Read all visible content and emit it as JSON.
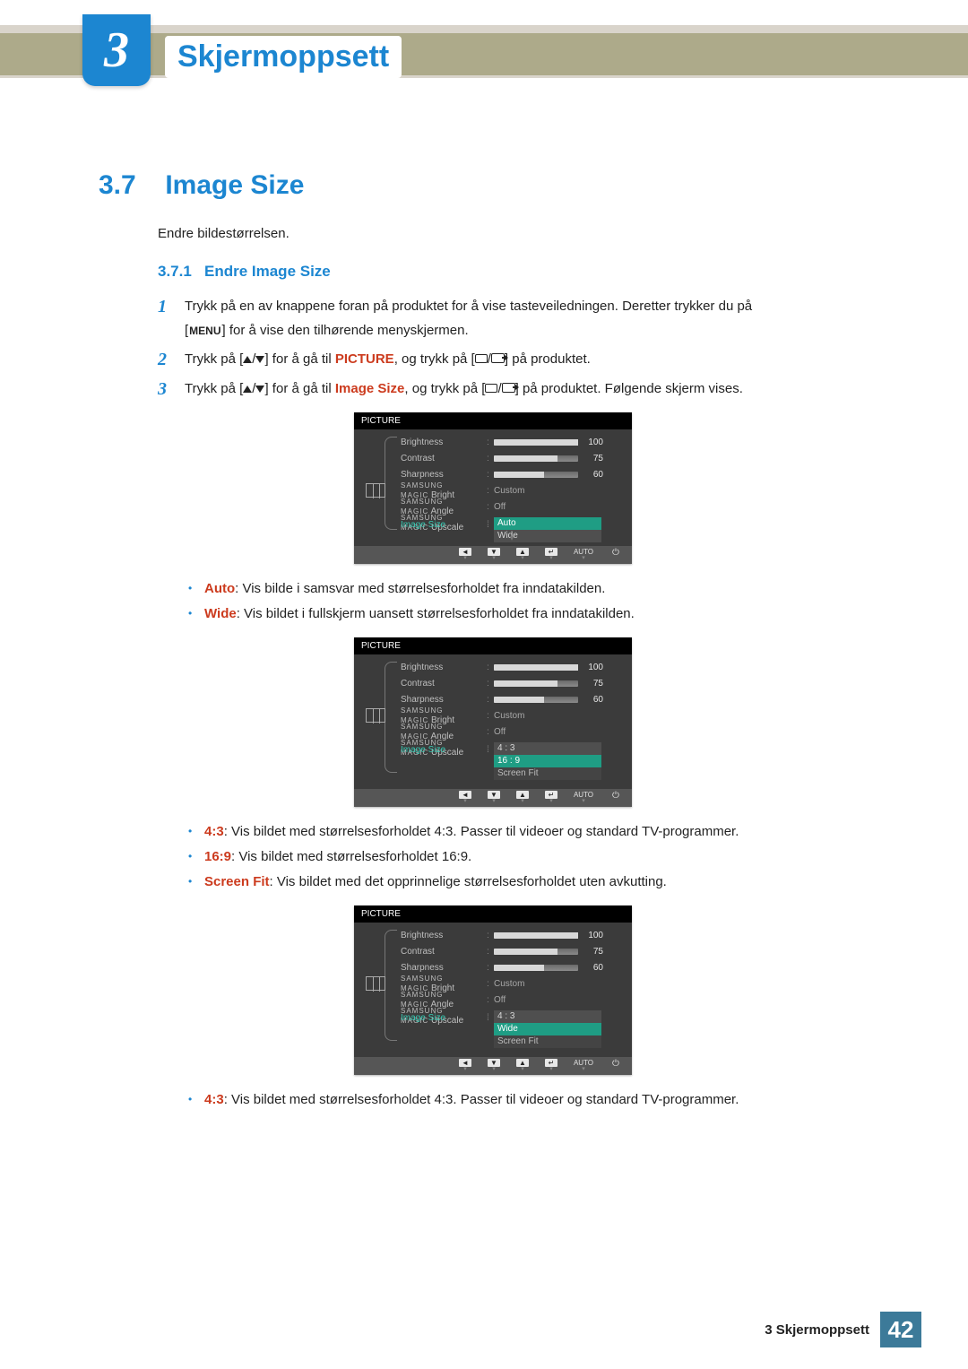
{
  "chapter": {
    "number": "3",
    "title": "Skjermoppsett"
  },
  "section": {
    "number": "3.7",
    "title": "Image Size"
  },
  "intro": "Endre bildestørrelsen.",
  "subsection": {
    "number": "3.7.1",
    "title": "Endre Image Size"
  },
  "steps": {
    "s1": {
      "num": "1",
      "line1": "Trykk på en av knappene foran på produktet for å vise tasteveiledningen. Deretter trykker du på",
      "line2_pre": "[",
      "menu": "MENU",
      "line2_post": "] for å vise den tilhørende menyskjermen."
    },
    "s2": {
      "num": "2",
      "t0": "Trykk på [",
      "t1": "/",
      "t2": "] for å gå til ",
      "hl": "PICTURE",
      "t3": ", og trykk på [",
      "t4": "/",
      "t5": "] på produktet."
    },
    "s3": {
      "num": "3",
      "t0": "Trykk på [",
      "t1": "/",
      "t2": "] for å gå til ",
      "hl": "Image Size",
      "t3": ", og trykk på [",
      "t4": "/",
      "t5": "] på produktet. Følgende skjerm vises."
    }
  },
  "osd": {
    "header": "PICTURE",
    "brightness": {
      "label": "Brightness",
      "value": 100,
      "pct": 100
    },
    "contrast": {
      "label": "Contrast",
      "value": 75,
      "pct": 75
    },
    "sharpness": {
      "label": "Sharpness",
      "value": 60,
      "pct": 60
    },
    "magic_prefix": "SAMSUNG",
    "magic_brand": "MAGIC",
    "magic_bright": {
      "suffix": "Bright",
      "value": "Custom"
    },
    "magic_angle": {
      "suffix": "Angle",
      "value": "Off"
    },
    "magic_upscale": {
      "suffix": "Upscale"
    },
    "image_size_label": "Image Size",
    "footer_auto": "AUTO"
  },
  "osd1_options": {
    "o1": "Auto",
    "o2": "Wide"
  },
  "osd2_options": {
    "o1": "4 : 3",
    "o2": "16 : 9",
    "o3": "Screen Fit"
  },
  "osd3_options": {
    "o1": "4 : 3",
    "o2": "Wide",
    "o3": "Screen Fit"
  },
  "bullets1": {
    "b1": {
      "k": "Auto",
      "v": ": Vis bilde i samsvar med størrelsesforholdet fra inndatakilden."
    },
    "b2": {
      "k": "Wide",
      "v": ": Vis bildet i fullskjerm uansett størrelsesforholdet fra inndatakilden."
    }
  },
  "bullets2": {
    "b1": {
      "k": "4:3",
      "v": ": Vis bildet med størrelsesforholdet 4:3. Passer til videoer og standard TV-programmer."
    },
    "b2": {
      "k": "16:9",
      "v": ": Vis bildet med størrelsesforholdet 16:9."
    },
    "b3": {
      "k": "Screen Fit",
      "v": ": Vis bildet med det opprinnelige størrelsesforholdet uten avkutting."
    }
  },
  "bullets3": {
    "b1": {
      "k": "4:3",
      "v": ": Vis bildet med størrelsesforholdet 4:3. Passer til videoer og standard TV-programmer."
    }
  },
  "footer": {
    "text": "3 Skjermoppsett",
    "page": "42"
  }
}
